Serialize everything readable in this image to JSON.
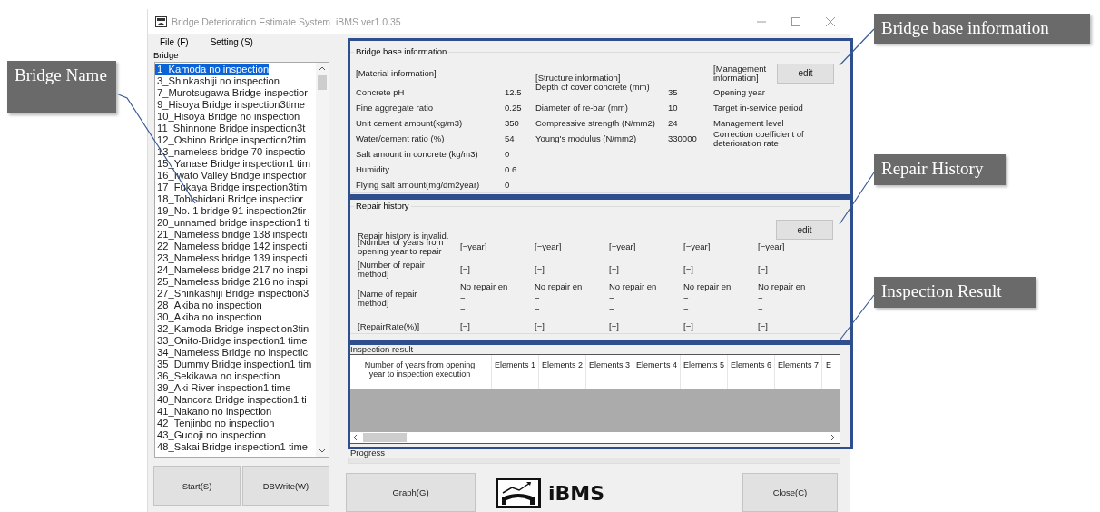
{
  "window": {
    "title": "Bridge Deterioration Estimate System  iBMS ver1.0.35"
  },
  "menu": [
    "File (F)",
    "Setting (S)"
  ],
  "bridge_list": {
    "label": "Bridge",
    "items": [
      {
        "label": "1_Kamoda no inspection",
        "selected": true
      },
      {
        "label": "3_Shinkashiji no inspection",
        "selected": false
      },
      {
        "label": "7_Murotsugawa Bridge inspectior",
        "selected": false
      },
      {
        "label": "9_Hisoya Bridge inspection3time",
        "selected": false
      },
      {
        "label": "10_Hisoya Bridge no inspection",
        "selected": false
      },
      {
        "label": "11_Shinnone Bridge inspection3t",
        "selected": false
      },
      {
        "label": "12_Oshino Bridge inspection2tim",
        "selected": false
      },
      {
        "label": "13_nameless bridge 70 inspectio",
        "selected": false
      },
      {
        "label": "15_Yanase Bridge inspection1 tim",
        "selected": false
      },
      {
        "label": "16_Iwato Valley Bridge inspectior",
        "selected": false
      },
      {
        "label": "17_Fukaya Bridge inspection3tim",
        "selected": false
      },
      {
        "label": "18_Tobishidani Bridge inspectior",
        "selected": false
      },
      {
        "label": "19_No. 1 bridge 91 inspection2tir",
        "selected": false
      },
      {
        "label": "20_unnamed bridge inspection1 ti",
        "selected": false
      },
      {
        "label": "21_Nameless bridge 138 inspecti",
        "selected": false
      },
      {
        "label": "22_Nameless bridge 142 inspecti",
        "selected": false
      },
      {
        "label": "23_Nameless bridge 139 inspecti",
        "selected": false
      },
      {
        "label": "24_Nameless bridge 217 no inspi",
        "selected": false
      },
      {
        "label": "25_Nameless bridge 216 no inspi",
        "selected": false
      },
      {
        "label": "27_Shinkashiji Bridge inspection3",
        "selected": false
      },
      {
        "label": "28_Akiba no inspection",
        "selected": false
      },
      {
        "label": "30_Akiba no inspection",
        "selected": false
      },
      {
        "label": "32_Kamoda Bridge inspection3tin",
        "selected": false
      },
      {
        "label": "33_Onito-Bridge inspection1 time",
        "selected": false
      },
      {
        "label": "34_Nameless Bridge no inspectic",
        "selected": false
      },
      {
        "label": "35_Dummy Bridge inspection1 tim",
        "selected": false
      },
      {
        "label": "36_Sekikawa no inspection",
        "selected": false
      },
      {
        "label": "39_Aki River inspection1 time",
        "selected": false
      },
      {
        "label": "40_Nancora Bridge inspection1 ti",
        "selected": false
      },
      {
        "label": "41_Nakano no inspection",
        "selected": false
      },
      {
        "label": "42_Tenjinbo no inspection",
        "selected": false
      },
      {
        "label": "43_Gudoji no inspection",
        "selected": false
      },
      {
        "label": "48_Sakai Bridge inspection1 time",
        "selected": false
      }
    ]
  },
  "left_buttons": [
    "Start(S)",
    "DBWrite(W)"
  ],
  "base_info": {
    "title": "Bridge base information",
    "edit": "edit",
    "material": {
      "heading": "[Material information]",
      "rows": [
        {
          "label": "Concrete pH",
          "value": "12.5"
        },
        {
          "label": "Fine aggregate ratio",
          "value": "0.25"
        },
        {
          "label": "Unit cement amount(kg/m3)",
          "value": "350"
        },
        {
          "label": "Water/cement ratio (%)",
          "value": "54"
        },
        {
          "label": "Salt amount in concrete (kg/m3)",
          "value": "0"
        },
        {
          "label": "Humidity",
          "value": "0.6"
        },
        {
          "label": "Flying salt amount(mg/dm2year)",
          "value": "0"
        }
      ]
    },
    "structure": {
      "heading": "[Structure information]",
      "rows": [
        {
          "label": "Depth of cover concrete (mm)",
          "value": "35"
        },
        {
          "label": "Diameter of re-bar (mm)",
          "value": "10"
        },
        {
          "label": "Compressive strength (N/mm2)",
          "value": "24"
        },
        {
          "label": "Young's modulus  (N/mm2)",
          "value": "330000"
        }
      ]
    },
    "management": {
      "heading": "[Management information]",
      "rows": [
        "Opening year",
        "Target in-service period",
        "Management level",
        "Correction coefficient of deterioration rate"
      ]
    }
  },
  "repair_history": {
    "title": "Repair history",
    "status": "Repair history is invalid.",
    "edit": "edit",
    "rows": [
      {
        "label": "[Number of years from opening year to repair",
        "cells": [
          [
            "[−year]"
          ],
          [
            "[−year]"
          ],
          [
            "[−year]"
          ],
          [
            "[−year]"
          ],
          [
            "[−year]"
          ]
        ]
      },
      {
        "label": "[Number of repair method]",
        "cells": [
          [
            "[−]"
          ],
          [
            "[−]"
          ],
          [
            "[−]"
          ],
          [
            "[−]"
          ],
          [
            "[−]"
          ]
        ]
      },
      {
        "label": "[Name of repair method]",
        "cells": [
          [
            "No repair en",
            "−",
            "−"
          ],
          [
            "No repair en",
            "−",
            "−"
          ],
          [
            "No repair en",
            "−",
            "−"
          ],
          [
            "No repair en",
            "−",
            "−"
          ],
          [
            "No repair en",
            "−",
            "−"
          ]
        ]
      },
      {
        "label": "[RepairRate(%)]",
        "cells": [
          [
            "[−]"
          ],
          [
            "[−]"
          ],
          [
            "[−]"
          ],
          [
            "[−]"
          ],
          [
            "[−]"
          ]
        ]
      }
    ]
  },
  "inspection": {
    "title": "Inspection result",
    "columns": [
      "Number of years from opening year to inspection execution",
      "Elements 1",
      "Elements 2",
      "Elements 3",
      "Elements 4",
      "Elements 5",
      "Elements 6",
      "Elements 7",
      "E"
    ]
  },
  "progress": {
    "label": "Progress"
  },
  "bottom_buttons": [
    "Graph(G)",
    "Close(C)"
  ],
  "logo": {
    "text": "iBMS"
  },
  "callouts": [
    {
      "text": "Bridge Name"
    },
    {
      "text": "Bridge base information"
    },
    {
      "text": "Repair History"
    },
    {
      "text": "Inspection Result"
    }
  ]
}
